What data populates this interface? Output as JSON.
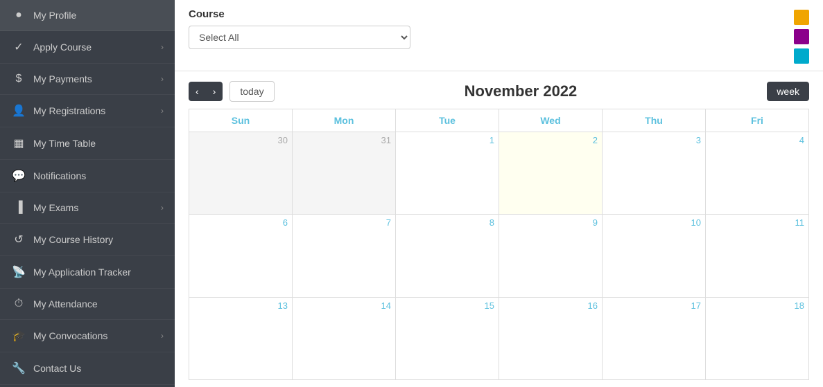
{
  "sidebar": {
    "items": [
      {
        "id": "my-profile",
        "label": "My Profile",
        "icon": "👤",
        "hasChevron": false
      },
      {
        "id": "apply-course",
        "label": "Apply Course",
        "icon": "✅",
        "hasChevron": true
      },
      {
        "id": "my-payments",
        "label": "My Payments",
        "icon": "$",
        "hasChevron": true
      },
      {
        "id": "my-registrations",
        "label": "My Registrations",
        "icon": "👥",
        "hasChevron": true
      },
      {
        "id": "my-timetable",
        "label": "My Time Table",
        "icon": "📅",
        "hasChevron": false
      },
      {
        "id": "notifications",
        "label": "Notifications",
        "icon": "💬",
        "hasChevron": false
      },
      {
        "id": "my-exams",
        "label": "My Exams",
        "icon": "📊",
        "hasChevron": true
      },
      {
        "id": "my-course-history",
        "label": "My Course History",
        "icon": "🔄",
        "hasChevron": false
      },
      {
        "id": "my-application-tracker",
        "label": "My Application Tracker",
        "icon": "📡",
        "hasChevron": false
      },
      {
        "id": "my-attendance",
        "label": "My Attendance",
        "icon": "🕐",
        "hasChevron": false
      },
      {
        "id": "my-convocations",
        "label": "My Convocations",
        "icon": "🎓",
        "hasChevron": true
      },
      {
        "id": "contact-us",
        "label": "Contact Us",
        "icon": "🔧",
        "hasChevron": false
      }
    ]
  },
  "course_selector": {
    "label": "Course",
    "placeholder": "Select All",
    "options": [
      "Select All"
    ]
  },
  "colors": [
    "#f0a500",
    "#8b008b",
    "#00aacc"
  ],
  "calendar": {
    "title": "November 2022",
    "prev_label": "‹",
    "next_label": "›",
    "today_label": "today",
    "week_label": "week",
    "days": [
      "Sun",
      "Mon",
      "Tue",
      "Wed",
      "Thu",
      "Fri"
    ],
    "rows": [
      [
        {
          "date": "30",
          "type": "outside"
        },
        {
          "date": "31",
          "type": "outside"
        },
        {
          "date": "1",
          "type": "current"
        },
        {
          "date": "2",
          "type": "today"
        },
        {
          "date": "3",
          "type": "current"
        },
        {
          "date": "4",
          "type": "current"
        }
      ],
      [
        {
          "date": "6",
          "type": "current"
        },
        {
          "date": "7",
          "type": "current"
        },
        {
          "date": "8",
          "type": "current"
        },
        {
          "date": "9",
          "type": "current"
        },
        {
          "date": "10",
          "type": "current"
        },
        {
          "date": "11",
          "type": "current"
        }
      ],
      [
        {
          "date": "13",
          "type": "current"
        },
        {
          "date": "14",
          "type": "current"
        },
        {
          "date": "15",
          "type": "current"
        },
        {
          "date": "16",
          "type": "current"
        },
        {
          "date": "17",
          "type": "current"
        },
        {
          "date": "18",
          "type": "current"
        }
      ]
    ]
  }
}
